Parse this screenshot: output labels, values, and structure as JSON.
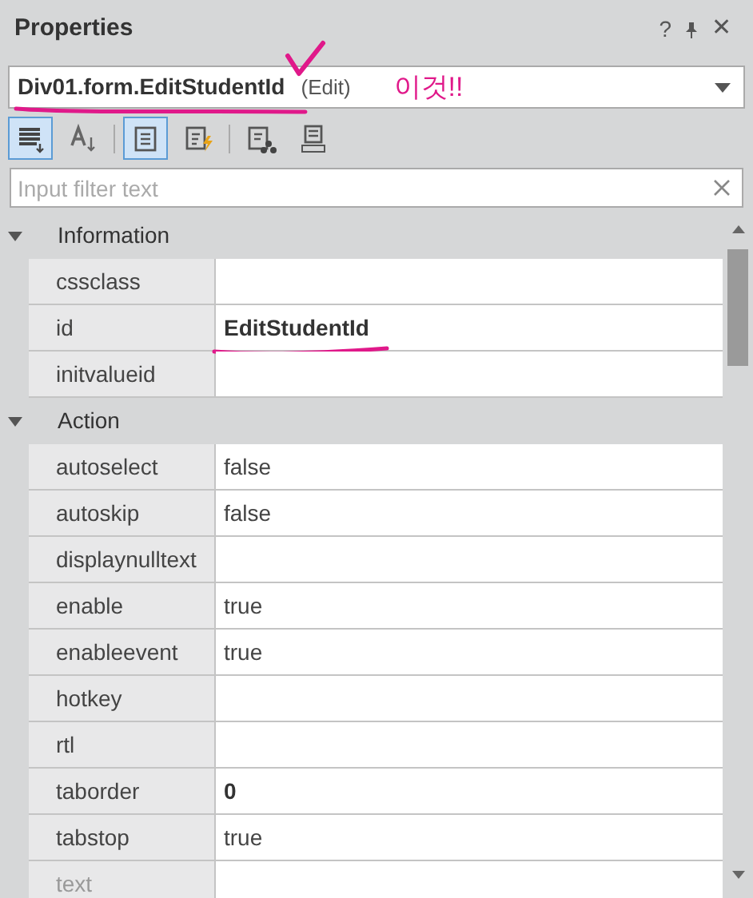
{
  "panel": {
    "title": "Properties",
    "header_buttons": [
      "?",
      "✕"
    ]
  },
  "object_selector": {
    "name": "Div01.form.EditStudentId",
    "type": "(Edit)"
  },
  "annotation": {
    "note": "이것!!"
  },
  "toolbar": [
    {
      "kind": "categorized",
      "selected": true
    },
    {
      "kind": "alphabetical",
      "selected": false
    },
    {
      "kind": "properties",
      "selected": true
    },
    {
      "kind": "events",
      "selected": false
    },
    {
      "kind": "bind",
      "selected": false
    },
    {
      "kind": "init",
      "selected": false
    }
  ],
  "filter": {
    "placeholder": "Input filter text"
  },
  "categories": [
    {
      "name": "Information",
      "expanded": true,
      "properties": [
        {
          "name": "cssclass",
          "dimmed": false,
          "marked": false
        },
        {
          "name": "id",
          "value": "EditStudentId",
          "modified": true,
          "dimmed": false,
          "marked": true
        },
        {
          "name": "initvalueid",
          "dimmed": false,
          "marked": false
        }
      ]
    },
    {
      "name": "Action",
      "expanded": true,
      "properties": [
        {
          "name": "autoselect",
          "value": "false",
          "modified": false,
          "dimmed": false,
          "marked": false
        },
        {
          "name": "autoskip",
          "value": "false",
          "modified": false,
          "dimmed": false,
          "marked": false
        },
        {
          "name": "displaynulltext",
          "dimmed": false,
          "marked": false
        },
        {
          "name": "enable",
          "value": "true",
          "modified": false,
          "dimmed": false,
          "marked": false
        },
        {
          "name": "enableevent",
          "value": "true",
          "modified": false,
          "dimmed": false,
          "marked": false
        },
        {
          "name": "hotkey",
          "dimmed": false,
          "marked": false
        },
        {
          "name": "rtl",
          "dimmed": false,
          "marked": false
        },
        {
          "name": "taborder",
          "value": "0",
          "modified": true,
          "dimmed": false,
          "marked": false
        },
        {
          "name": "tabstop",
          "value": "true",
          "modified": false,
          "dimmed": false,
          "marked": false
        },
        {
          "name": "text",
          "dimmed": true,
          "marked": false
        }
      ]
    }
  ]
}
